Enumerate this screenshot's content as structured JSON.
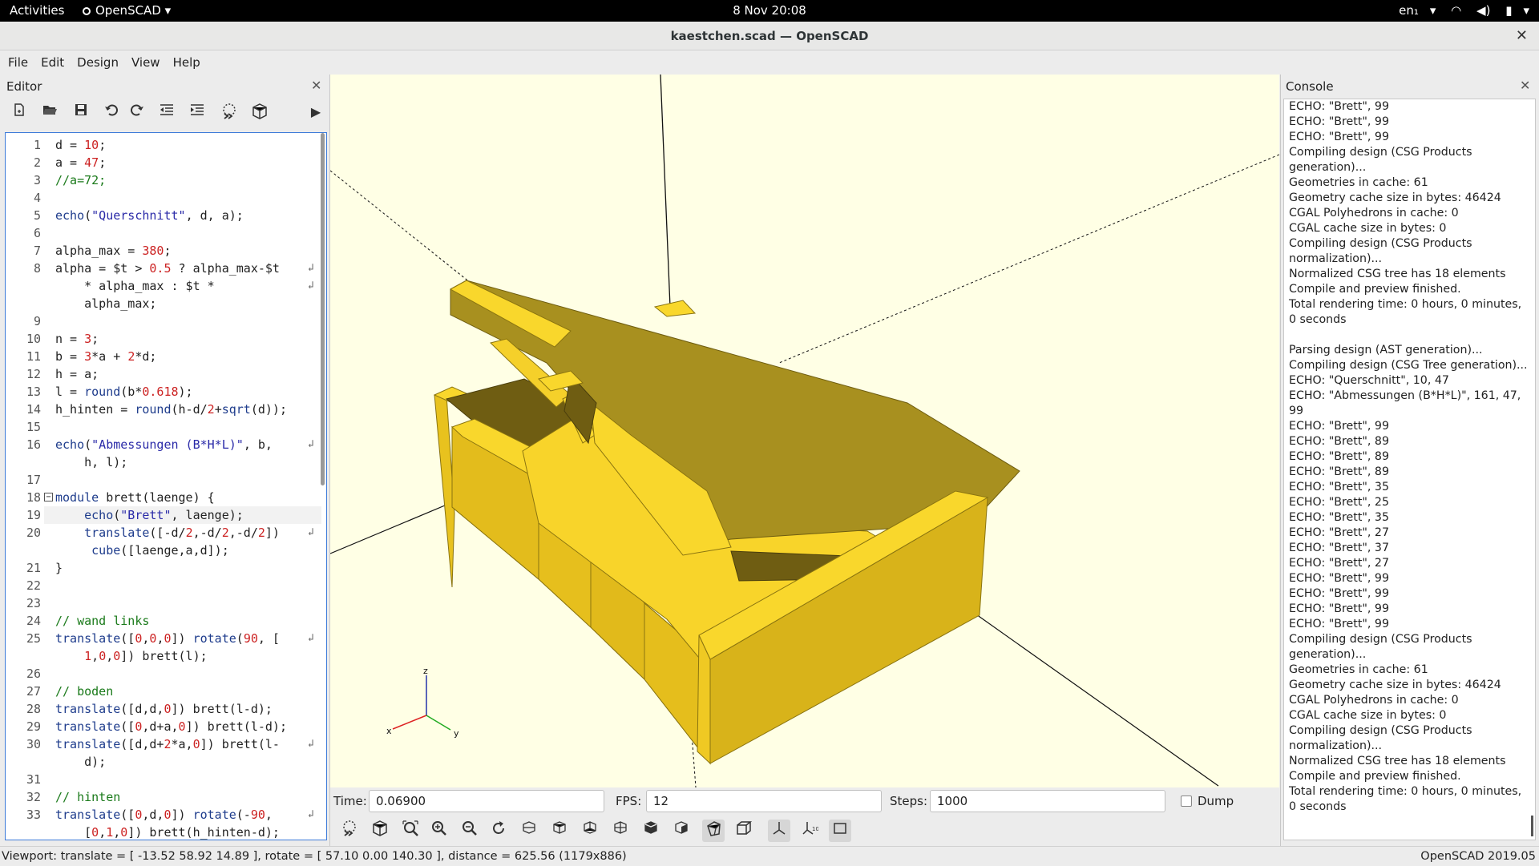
{
  "topbar": {
    "activities": "Activities",
    "app": "OpenSCAD",
    "clock": "8 Nov 20:08",
    "lang": "en₁"
  },
  "window": {
    "title": "kaestchen.scad — OpenSCAD",
    "close": "✕"
  },
  "menu": [
    "File",
    "Edit",
    "Design",
    "View",
    "Help"
  ],
  "editor": {
    "title": "Editor",
    "close": "✕"
  },
  "code_lines": [
    {
      "n": "1",
      "html": "d = <span class='kw-num'>10</span>;"
    },
    {
      "n": "2",
      "html": "a = <span class='kw-num'>47</span>;"
    },
    {
      "n": "3",
      "html": "<span class='kw-cm'>//a=72;</span>"
    },
    {
      "n": "4",
      "html": ""
    },
    {
      "n": "5",
      "html": "<span class='kw-fn'>echo</span>(<span class='kw-str'>\"Querschnitt\"</span>, d, a);"
    },
    {
      "n": "6",
      "html": ""
    },
    {
      "n": "7",
      "html": "alpha_max = <span class='kw-num'>380</span>;"
    },
    {
      "n": "8",
      "html": "alpha = $t &gt; <span class='kw-num'>0.5</span> ? alpha_max-$t",
      "wrap": true
    },
    {
      "n": "",
      "html": "    * alpha_max : $t *",
      "wrap": true
    },
    {
      "n": "",
      "html": "    alpha_max;"
    },
    {
      "n": "9",
      "html": ""
    },
    {
      "n": "10",
      "html": "n = <span class='kw-num'>3</span>;"
    },
    {
      "n": "11",
      "html": "b = <span class='kw-num'>3</span>*a + <span class='kw-num'>2</span>*d;"
    },
    {
      "n": "12",
      "html": "h = a;"
    },
    {
      "n": "13",
      "html": "l = <span class='kw-fn'>round</span>(b*<span class='kw-num'>0.618</span>);"
    },
    {
      "n": "14",
      "html": "h_hinten = <span class='kw-fn'>round</span>(h-d/<span class='kw-num'>2</span>+<span class='kw-fn'>sqrt</span>(d));"
    },
    {
      "n": "15",
      "html": ""
    },
    {
      "n": "16",
      "html": "<span class='kw-fn'>echo</span>(<span class='kw-str'>\"Abmessungen (B*H*L)\"</span>, b,",
      "wrap": true
    },
    {
      "n": "",
      "html": "    h, l);"
    },
    {
      "n": "17",
      "html": ""
    },
    {
      "n": "18",
      "html": "<span class='kw-fn'>module</span> brett(laenge) {",
      "fold": true
    },
    {
      "n": "19",
      "html": "    <span class='kw-fn'>echo</span>(<span class='kw-str'>\"Brett\"</span>, laenge);",
      "cur": true
    },
    {
      "n": "20",
      "html": "    <span class='kw-fn'>translate</span>([-d/<span class='kw-num'>2</span>,-d/<span class='kw-num'>2</span>,-d/<span class='kw-num'>2</span>])",
      "wrap": true
    },
    {
      "n": "",
      "html": "     <span class='kw-fn'>cube</span>([laenge,a,d]);"
    },
    {
      "n": "21",
      "html": "}"
    },
    {
      "n": "22",
      "html": ""
    },
    {
      "n": "23",
      "html": ""
    },
    {
      "n": "24",
      "html": "<span class='kw-cm'>// wand links</span>"
    },
    {
      "n": "25",
      "html": "<span class='kw-fn'>translate</span>([<span class='kw-num'>0</span>,<span class='kw-num'>0</span>,<span class='kw-num'>0</span>]) <span class='kw-fn'>rotate</span>(<span class='kw-num'>90</span>, [",
      "wrap": true
    },
    {
      "n": "",
      "html": "    <span class='kw-num'>1</span>,<span class='kw-num'>0</span>,<span class='kw-num'>0</span>]) brett(l);"
    },
    {
      "n": "26",
      "html": ""
    },
    {
      "n": "27",
      "html": "<span class='kw-cm'>// boden</span>"
    },
    {
      "n": "28",
      "html": "<span class='kw-fn'>translate</span>([d,d,<span class='kw-num'>0</span>]) brett(l-d);"
    },
    {
      "n": "29",
      "html": "<span class='kw-fn'>translate</span>([<span class='kw-num'>0</span>,d+a,<span class='kw-num'>0</span>]) brett(l-d);"
    },
    {
      "n": "30",
      "html": "<span class='kw-fn'>translate</span>([d,d+<span class='kw-num'>2</span>*a,<span class='kw-num'>0</span>]) brett(l-",
      "wrap": true
    },
    {
      "n": "",
      "html": "    d);"
    },
    {
      "n": "31",
      "html": ""
    },
    {
      "n": "32",
      "html": "<span class='kw-cm'>// hinten</span>"
    },
    {
      "n": "33",
      "html": "<span class='kw-fn'>translate</span>([<span class='kw-num'>0</span>,d,<span class='kw-num'>0</span>]) <span class='kw-fn'>rotate</span>(-<span class='kw-num'>90</span>,",
      "wrap": true
    },
    {
      "n": "",
      "html": "    [<span class='kw-num'>0</span>,<span class='kw-num'>1</span>,<span class='kw-num'>0</span>]) brett(h_hinten-d);"
    }
  ],
  "animation": {
    "time_label": "Time:",
    "time_value": "0.06900",
    "fps_label": "FPS:",
    "fps_value": "12",
    "steps_label": "Steps:",
    "steps_value": "1000",
    "dump_label": "Dump Pictures"
  },
  "axes": {
    "x": "x",
    "y": "y",
    "z": "z"
  },
  "console": {
    "title": "Console",
    "close": "✕",
    "lines": [
      "ECHO: \"Brett\", 99",
      "ECHO: \"Brett\", 99",
      "ECHO: \"Brett\", 99",
      "Compiling design (CSG Products generation)...",
      "Geometries in cache: 61",
      "Geometry cache size in bytes: 46424",
      "CGAL Polyhedrons in cache: 0",
      "CGAL cache size in bytes: 0",
      "Compiling design (CSG Products normalization)...",
      "Normalized CSG tree has 18 elements",
      "Compile and preview finished.",
      "Total rendering time: 0 hours, 0 minutes, 0 seconds",
      " ",
      "Parsing design (AST generation)...",
      "Compiling design (CSG Tree generation)...",
      "ECHO: \"Querschnitt\", 10, 47",
      "ECHO: \"Abmessungen (B*H*L)\", 161, 47, 99",
      "ECHO: \"Brett\", 99",
      "ECHO: \"Brett\", 89",
      "ECHO: \"Brett\", 89",
      "ECHO: \"Brett\", 89",
      "ECHO: \"Brett\", 35",
      "ECHO: \"Brett\", 25",
      "ECHO: \"Brett\", 35",
      "ECHO: \"Brett\", 27",
      "ECHO: \"Brett\", 37",
      "ECHO: \"Brett\", 27",
      "ECHO: \"Brett\", 99",
      "ECHO: \"Brett\", 99",
      "ECHO: \"Brett\", 99",
      "ECHO: \"Brett\", 99",
      "Compiling design (CSG Products generation)...",
      "Geometries in cache: 61",
      "Geometry cache size in bytes: 46424",
      "CGAL Polyhedrons in cache: 0",
      "CGAL cache size in bytes: 0",
      "Compiling design (CSG Products normalization)...",
      "Normalized CSG tree has 18 elements",
      "Compile and preview finished.",
      "Total rendering time: 0 hours, 0 minutes, 0 seconds"
    ]
  },
  "status": {
    "viewport": "Viewport: translate = [ -13.52 58.92 14.89 ], rotate = [ 57.10 0.00 140.30 ], distance = 625.56 (1179x886)",
    "version": "OpenSCAD 2019.05"
  },
  "colors": {
    "viewport_bg": "#ffffe5",
    "model_top": "#f9d72c",
    "model_side": "#e8c21e",
    "model_dark": "#a89020",
    "model_shadow": "#6f5d12"
  }
}
